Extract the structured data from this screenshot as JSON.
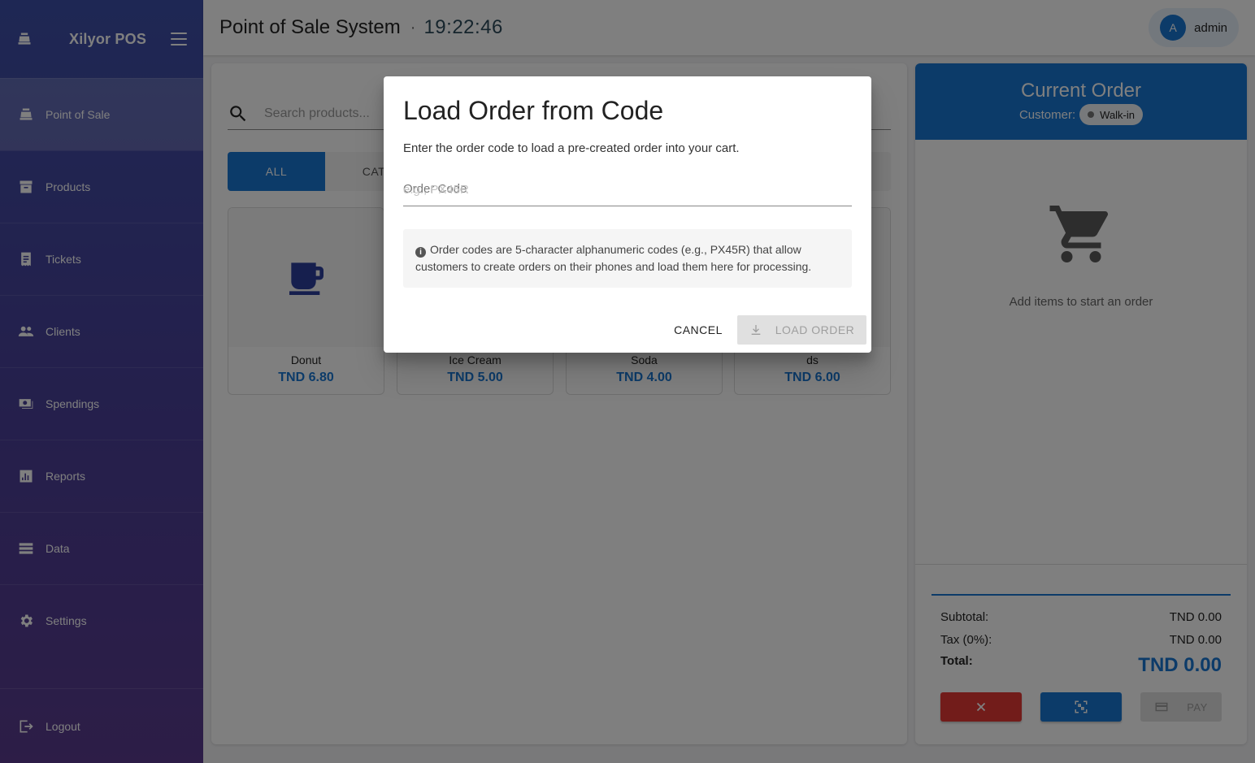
{
  "app": {
    "brand": "Xilyor POS"
  },
  "sidebar": {
    "items": [
      {
        "label": "Point of Sale",
        "icon": "register-icon",
        "active": true
      },
      {
        "label": "Products",
        "icon": "archive-icon"
      },
      {
        "label": "Tickets",
        "icon": "receipt-icon"
      },
      {
        "label": "Clients",
        "icon": "people-icon"
      },
      {
        "label": "Spendings",
        "icon": "money-icon"
      },
      {
        "label": "Reports",
        "icon": "bar-chart-icon"
      },
      {
        "label": "Data",
        "icon": "storage-icon"
      },
      {
        "label": "Settings",
        "icon": "gear-icon"
      }
    ],
    "logout_label": "Logout"
  },
  "header": {
    "title": "Point of Sale System",
    "separator": "·",
    "clock": "19:22:46",
    "user": {
      "initial": "A",
      "name": "admin"
    }
  },
  "products": {
    "search_placeholder": "Search products...",
    "categories": [
      "ALL",
      "CAT"
    ],
    "items": [
      {
        "name": "Donut",
        "price": "TND 6.80"
      },
      {
        "name": "Ice Cream",
        "price": "TND 5.00"
      },
      {
        "name": "Soda",
        "price": "TND 4.00"
      },
      {
        "name": "ds",
        "price": "TND 6.00"
      }
    ]
  },
  "order": {
    "title": "Current Order",
    "customer_label": "Customer:",
    "customer": "Walk-in",
    "empty_message": "Add items to start an order",
    "subtotal_label": "Subtotal:",
    "subtotal": "TND 0.00",
    "tax_label": "Tax (0%):",
    "tax": "TND 0.00",
    "total_label": "Total:",
    "total": "TND 0.00",
    "pay_label": "PAY"
  },
  "dialog": {
    "title": "Load Order from Code",
    "description": "Enter the order code to load a pre-created order into your cart.",
    "field_label": "Order Code",
    "field_placeholder": "e.g., PX45R",
    "info_text": "Order codes are 5-character alphanumeric codes (e.g., PX45R) that allow customers to create orders on their phones and load them here for processing.",
    "cancel_label": "CANCEL",
    "load_label": "LOAD ORDER"
  },
  "colors": {
    "primary": "#1976d2",
    "danger": "#e53935",
    "sidebar": "#3d4fa8"
  }
}
